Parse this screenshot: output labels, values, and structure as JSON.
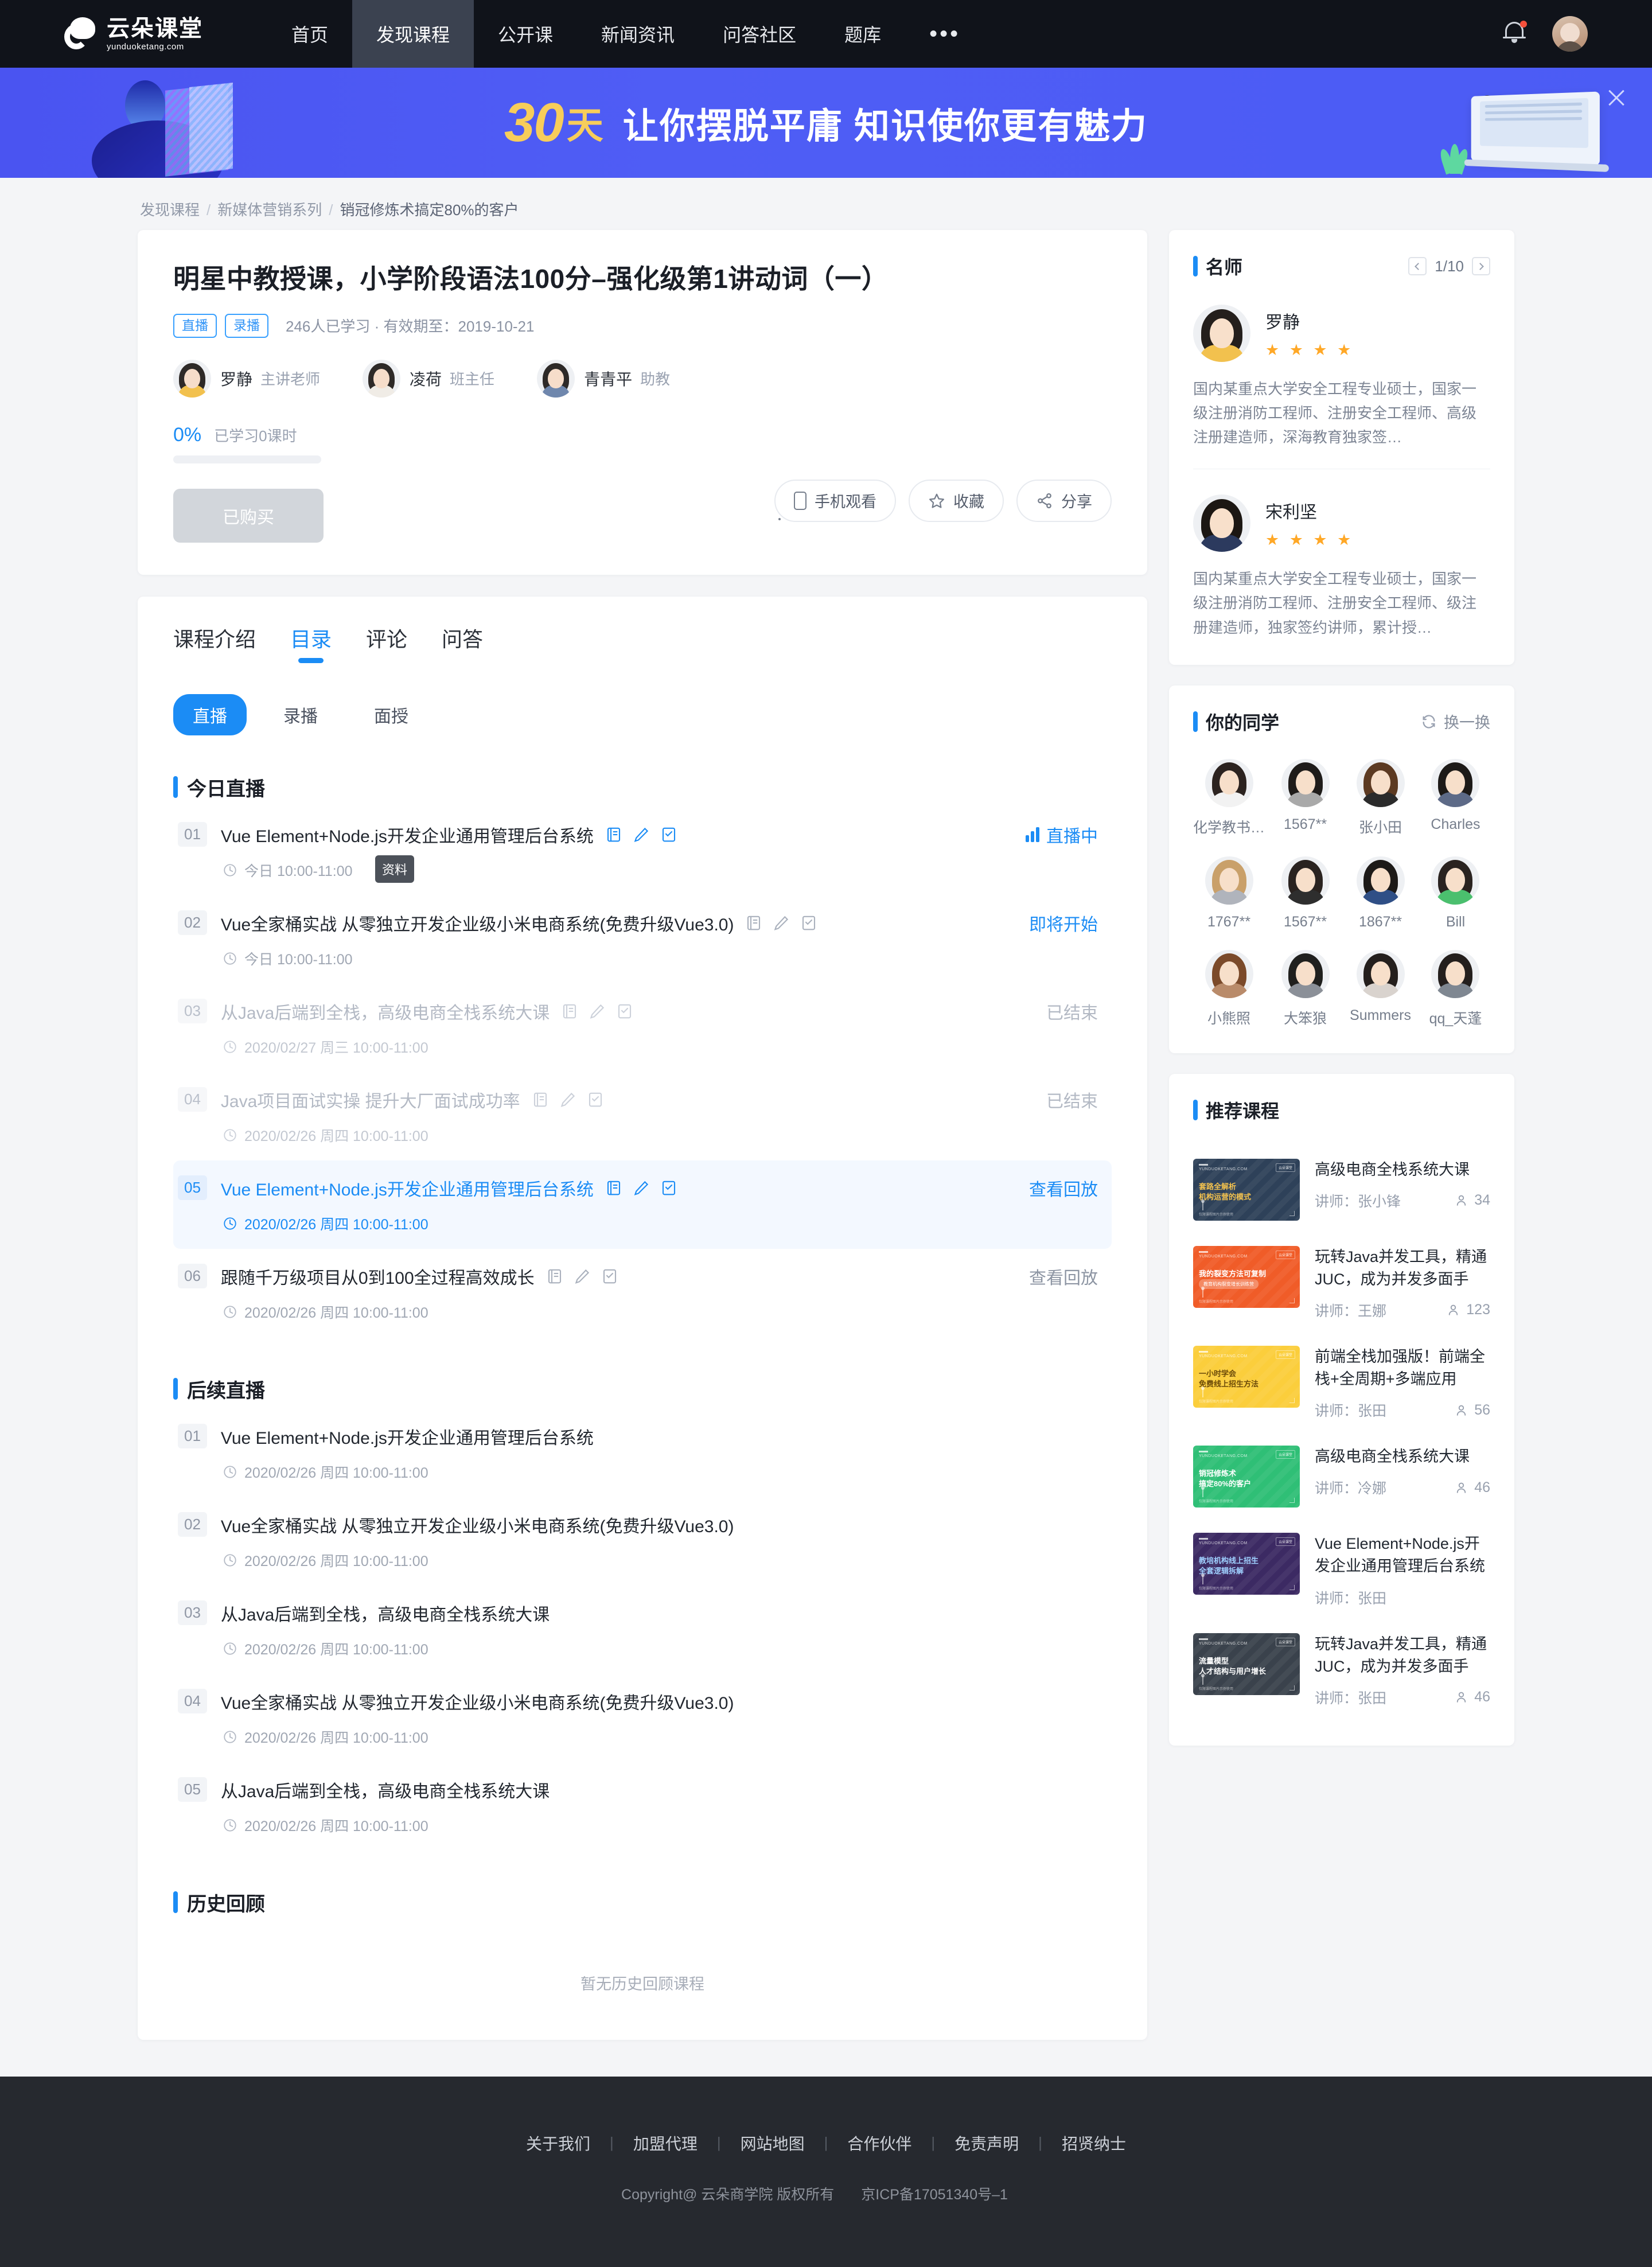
{
  "nav": {
    "logo_cn": "云朵课堂",
    "logo_en": "yunduoketang.com",
    "items": [
      {
        "label": "首页",
        "active": false
      },
      {
        "label": "发现课程",
        "active": true
      },
      {
        "label": "公开课",
        "active": false
      },
      {
        "label": "新闻资讯",
        "active": false
      },
      {
        "label": "问答社区",
        "active": false
      },
      {
        "label": "题库",
        "active": false
      }
    ],
    "more": "•••"
  },
  "banner": {
    "num": "30",
    "unit": "天",
    "rest": "让你摆脱平庸  知识使你更有魅力"
  },
  "breadcrumb": {
    "items": [
      "发现课程",
      "新媒体营销系列",
      "销冠修炼术搞定80%的客户"
    ]
  },
  "course": {
    "title": "明星中教授课，小学阶段语法100分–强化级第1讲动词（一）",
    "tags": [
      "直播",
      "录播"
    ],
    "meta": "246人已学习 · 有效期至：2019-10-21",
    "teachers": [
      {
        "name": "罗静",
        "role": "主讲老师",
        "color": "#f2c14e"
      },
      {
        "name": "凌荷",
        "role": "班主任",
        "color": "#f0ece6"
      },
      {
        "name": "青青平",
        "role": "助教",
        "color": "#6f87ad"
      }
    ],
    "progress_pct": "0%",
    "progress_label": "已学习0课时",
    "progress_value": 0,
    "buy_label": "已购买",
    "actions": [
      {
        "label": "手机观看",
        "icon": "phone-icon"
      },
      {
        "label": "收藏",
        "icon": "star-icon"
      },
      {
        "label": "分享",
        "icon": "share-icon"
      }
    ]
  },
  "tabs": [
    {
      "label": "课程介绍",
      "active": false
    },
    {
      "label": "目录",
      "active": true
    },
    {
      "label": "评论",
      "active": false
    },
    {
      "label": "问答",
      "active": false
    }
  ],
  "subtabs": [
    {
      "label": "直播",
      "active": true
    },
    {
      "label": "录播",
      "active": false
    },
    {
      "label": "面授",
      "active": false
    }
  ],
  "tooltip": "资料",
  "sections": {
    "today": {
      "title": "今日直播",
      "lessons": [
        {
          "num": "01",
          "title": "Vue Element+Node.js开发企业通用管理后台系统",
          "time": "今日 10:00-11:00",
          "status": "直播中",
          "state": "live",
          "icons": true
        },
        {
          "num": "02",
          "title": "Vue全家桶实战 从零独立开发企业级小米电商系统(免费升级Vue3.0)",
          "time": "今日 10:00-11:00",
          "status": "即将开始",
          "state": "soon",
          "icons": true
        },
        {
          "num": "03",
          "title": "从Java后端到全栈，高级电商全栈系统大课",
          "time": "2020/02/27 周三 10:00-11:00",
          "status": "已结束",
          "state": "ended",
          "icons": true
        },
        {
          "num": "04",
          "title": "Java项目面试实操 提升大厂面试成功率",
          "time": "2020/02/26 周四 10:00-11:00",
          "status": "已结束",
          "state": "ended",
          "icons": true
        },
        {
          "num": "05",
          "title": "Vue Element+Node.js开发企业通用管理后台系统",
          "time": "2020/02/26 周四 10:00-11:00",
          "status": "查看回放",
          "state": "highlight",
          "icons": true
        },
        {
          "num": "06",
          "title": "跟随千万级项目从0到100全过程高效成长",
          "time": "2020/02/26 周四 10:00-11:00",
          "status": "查看回放",
          "state": "replay",
          "icons": true
        }
      ]
    },
    "upcoming": {
      "title": "后续直播",
      "lessons": [
        {
          "num": "01",
          "title": "Vue Element+Node.js开发企业通用管理后台系统",
          "time": "2020/02/26 周四 10:00-11:00",
          "status": "",
          "state": "plain",
          "icons": false
        },
        {
          "num": "02",
          "title": "Vue全家桶实战 从零独立开发企业级小米电商系统(免费升级Vue3.0)",
          "time": "2020/02/26 周四 10:00-11:00",
          "status": "",
          "state": "plain",
          "icons": false
        },
        {
          "num": "03",
          "title": "从Java后端到全栈，高级电商全栈系统大课",
          "time": "2020/02/26 周四 10:00-11:00",
          "status": "",
          "state": "plain",
          "icons": false
        },
        {
          "num": "04",
          "title": "Vue全家桶实战 从零独立开发企业级小米电商系统(免费升级Vue3.0)",
          "time": "2020/02/26 周四 10:00-11:00",
          "status": "",
          "state": "plain",
          "icons": false
        },
        {
          "num": "05",
          "title": "从Java后端到全栈，高级电商全栈系统大课",
          "time": "2020/02/26 周四 10:00-11:00",
          "status": "",
          "state": "plain",
          "icons": false
        }
      ]
    },
    "history": {
      "title": "历史回顾",
      "empty": "暂无历史回顾课程"
    }
  },
  "famous": {
    "title": "名师",
    "page": "1/10",
    "teachers": [
      {
        "name": "罗静",
        "stars": "★ ★ ★ ★",
        "desc": "国内某重点大学安全工程专业硕士，国家一级注册消防工程师、注册安全工程师、高级注册建造师，深海教育独家签…",
        "hair": "#241f1c",
        "body": "#f2c14e"
      },
      {
        "name": "宋利坚",
        "stars": "★ ★ ★ ★",
        "desc": "国内某重点大学安全工程专业硕士，国家一级注册消防工程师、注册安全工程师、级注册建造师，独家签约讲师，累计授…",
        "hair": "#1c1713",
        "body": "#2c3a5e"
      }
    ]
  },
  "classmates": {
    "title": "你的同学",
    "refresh": "换一换",
    "people": [
      {
        "name": "化学教书…",
        "hair": "#2c2320",
        "body": "#f2f2f2"
      },
      {
        "name": "1567**",
        "hair": "#1f1c1a",
        "body": "#a9a9a9"
      },
      {
        "name": "张小田",
        "hair": "#5c3a22",
        "body": "#2b2b2b"
      },
      {
        "name": "Charles",
        "hair": "#1d1a18",
        "body": "#5d6a87"
      },
      {
        "name": "1767**",
        "hair": "#c9a06a",
        "body": "#b0b4bc"
      },
      {
        "name": "1567**",
        "hair": "#2a2320",
        "body": "#2e2e2e"
      },
      {
        "name": "1867**",
        "hair": "#1d1a18",
        "body": "#2f4f86"
      },
      {
        "name": "Bill",
        "hair": "#2a2320",
        "body": "#4bbf6e"
      },
      {
        "name": "小熊照",
        "hair": "#7b4a2a",
        "body": "#b98b6a"
      },
      {
        "name": "大笨狼",
        "hair": "#20201e",
        "body": "#8b9098"
      },
      {
        "name": "Summers",
        "hair": "#241f1d",
        "body": "#d9d3ce"
      },
      {
        "name": "qq_天蓬",
        "hair": "#241f1d",
        "body": "#7f8791"
      }
    ]
  },
  "recommended": {
    "title": "推荐课程",
    "items": [
      {
        "title": "高级电商全栈系统大课",
        "teacher_label": "讲师：张小锋",
        "count": "34",
        "thumb_bg": "#2e4159",
        "thumb_l1": "套路全解析",
        "thumb_l2": "机构运营的模式",
        "thumb_pill": "",
        "thumb_text_color": "#f2c14e",
        "thumb_foot": "仅限课程图片示例使用"
      },
      {
        "title": "玩转Java并发工具，精通JUC，成为并发多面手",
        "teacher_label": "讲师：王娜",
        "count": "123",
        "thumb_bg": "#f05c28",
        "thumb_l1": "我的裂变方法可复制",
        "thumb_l2": "",
        "thumb_pill": "教育机构裂变增长训练营",
        "thumb_text_color": "#ffffff",
        "thumb_foot": "仅限课程图片示例使用"
      },
      {
        "title": "前端全栈加强版！前端全栈+全周期+多端应用",
        "teacher_label": "讲师：张田",
        "count": "56",
        "thumb_bg": "#fbce3c",
        "thumb_l1": "一小时学会",
        "thumb_l2": "免费线上招生方法",
        "thumb_pill": "",
        "thumb_text_color": "#6b4a08",
        "thumb_foot": "仅限课程图片示例使用"
      },
      {
        "title": "高级电商全栈系统大课",
        "teacher_label": "讲师：冷娜",
        "count": "46",
        "thumb_bg": "#2fbf76",
        "thumb_l1": "销冠修炼术",
        "thumb_l2": "搞定80%的客户",
        "thumb_pill": "",
        "thumb_text_color": "#ffffff",
        "thumb_foot": "仅限课程图片示例使用"
      },
      {
        "title": "Vue Element+Node.js开发企业通用管理后台系统",
        "teacher_label": "讲师：张田",
        "count": "",
        "thumb_bg": "#3c2a63",
        "thumb_l1": "教培机构线上招生",
        "thumb_l2": "全套逻辑拆解",
        "thumb_pill": "",
        "thumb_text_color": "#9fd0ff",
        "thumb_foot": "仅限课程图片示例使用"
      },
      {
        "title": "玩转Java并发工具，精通JUC，成为并发多面手",
        "teacher_label": "讲师：张田",
        "count": "46",
        "thumb_bg": "#3a424c",
        "thumb_l1": "流量模型",
        "thumb_l2": "人才结构与用户增长",
        "thumb_pill": "",
        "thumb_text_color": "#ffffff",
        "thumb_foot": "仅限课程图片示例使用"
      }
    ]
  },
  "footer": {
    "links": [
      "关于我们",
      "加盟代理",
      "网站地图",
      "合作伙伴",
      "免责声明",
      "招贤纳士"
    ],
    "copyright": "Copyright@ 云朵商学院  版权所有",
    "icp": "京ICP备17051340号–1"
  },
  "colors": {
    "accent": "#1b8cf5",
    "banner_yellow": "#f7cd5a",
    "nav_bg": "#10131a",
    "footer_bg": "#26292f"
  }
}
